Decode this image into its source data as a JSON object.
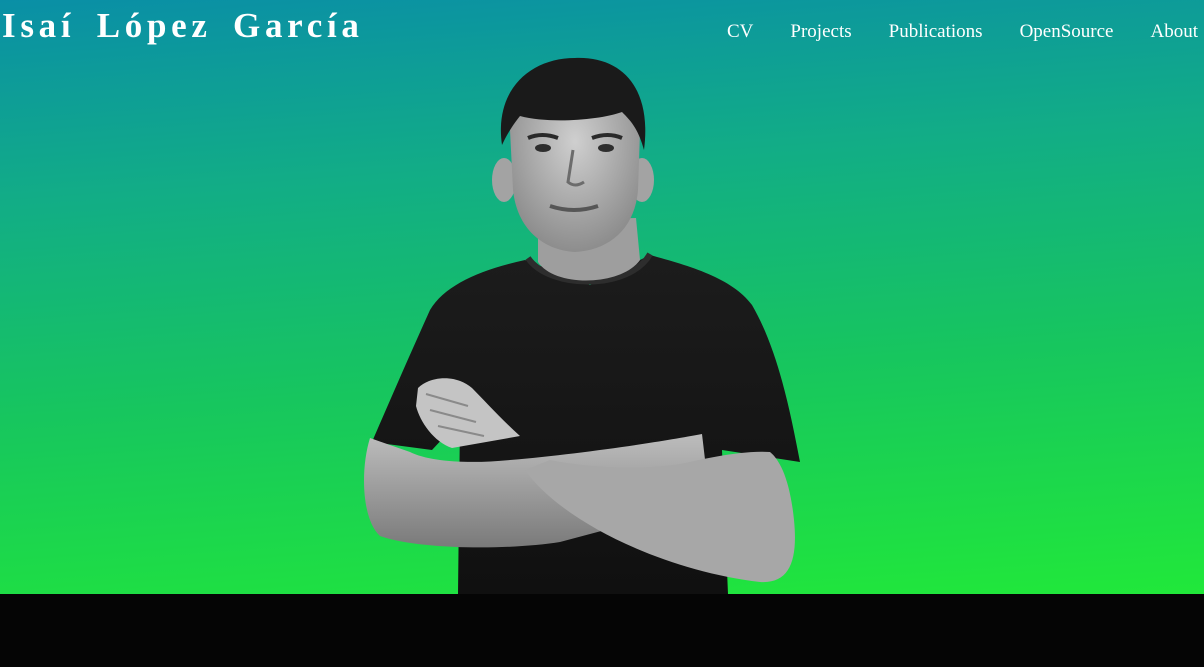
{
  "header": {
    "site_title": "Isaí López García",
    "nav": [
      {
        "label": "CV"
      },
      {
        "label": "Projects"
      },
      {
        "label": "Publications"
      },
      {
        "label": "OpenSource"
      },
      {
        "label": "About"
      }
    ]
  },
  "hero": {
    "gradient_colors": [
      "#0a8fa6",
      "#12ad86",
      "#17c65e",
      "#21e83a"
    ],
    "portrait_icon": "person-arms-crossed-portrait"
  },
  "footer": {
    "background_color": "#050505"
  }
}
